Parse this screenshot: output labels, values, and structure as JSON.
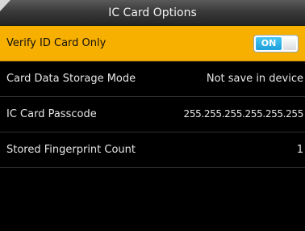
{
  "header": {
    "title": "IC Card Options",
    "back_icon": "back-arrow-icon"
  },
  "settings": [
    {
      "label": "Verify ID Card Only",
      "toggle": {
        "label": "ON",
        "state": "on"
      },
      "selected": true
    },
    {
      "label": "Card Data Storage Mode",
      "value": "Not save in device"
    },
    {
      "label": "IC Card Passcode",
      "value": "255.255.255.255.255.255"
    },
    {
      "label": "Stored Fingerprint Count",
      "value": "1"
    }
  ],
  "colors": {
    "selected_row": "#f8b000",
    "toggle_on": "#1e9fd9",
    "background": "#000000"
  }
}
